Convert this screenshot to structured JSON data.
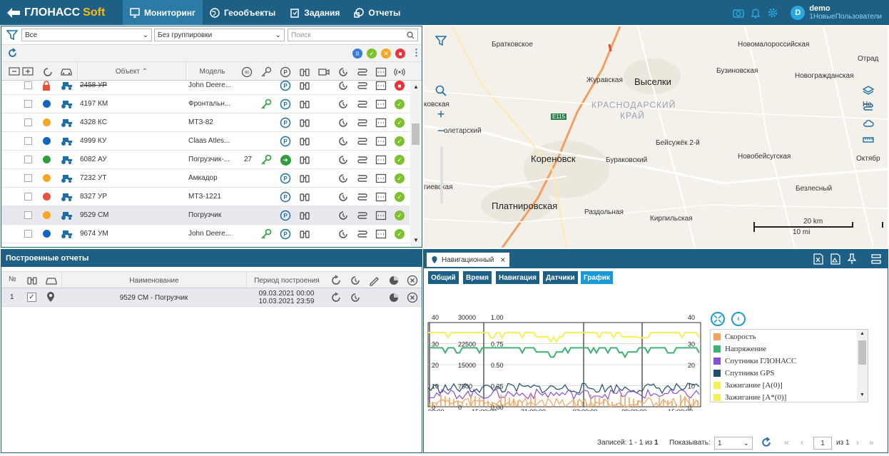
{
  "app": {
    "logo_main": "ГЛОНАСС",
    "logo_soft": "Soft"
  },
  "nav": [
    {
      "label": "Мониторинг",
      "icon": "monitor-icon",
      "active": true
    },
    {
      "label": "Геообъекты",
      "icon": "globe-icon"
    },
    {
      "label": "Задания",
      "icon": "clipboard-icon"
    },
    {
      "label": "Отчеты",
      "icon": "reports-icon"
    }
  ],
  "user": {
    "initial": "D",
    "name": "demo",
    "group": "1НовыеПользователи"
  },
  "monitoring": {
    "filter_value": "Все",
    "grouping_value": "Без группировки",
    "search_placeholder": "Поиск",
    "col_object": "Объект",
    "col_model": "Модель",
    "rows": [
      {
        "plate": "2458 УР",
        "model": "John Deere...",
        "status": "red-lock",
        "speed": "",
        "key": false,
        "p": "p",
        "ok": "lock"
      },
      {
        "plate": "4197 КМ",
        "model": "Фронтальн...",
        "status": "#1565c0",
        "speed": "",
        "key": true,
        "p": "p",
        "ok": "ok"
      },
      {
        "plate": "4328 КС",
        "model": "МТЗ-82",
        "status": "#f5a623",
        "speed": "",
        "key": false,
        "p": "p",
        "ok": "ok"
      },
      {
        "plate": "4999 КУ",
        "model": "Claas Atles...",
        "status": "#1565c0",
        "speed": "",
        "key": false,
        "p": "p",
        "ok": "ok"
      },
      {
        "plate": "6082 АУ",
        "model": "Погрузчик-...",
        "status": "#2e9d3a",
        "speed": "27",
        "key": true,
        "p": "go",
        "ok": "ok"
      },
      {
        "plate": "7232 УТ",
        "model": "Амкадор",
        "status": "#f5a623",
        "speed": "",
        "key": false,
        "p": "p",
        "ok": "ok"
      },
      {
        "plate": "8327 УР",
        "model": "МТЗ-1221",
        "status": "#e8513a",
        "speed": "",
        "key": false,
        "p": "p",
        "ok": "ok"
      },
      {
        "plate": "9529 СМ",
        "model": "Погрузчик",
        "status": "#f5a623",
        "speed": "",
        "key": false,
        "p": "p",
        "ok": "ok"
      },
      {
        "plate": "9674 УМ",
        "model": "John Deere...",
        "status": "#1565c0",
        "speed": "",
        "key": true,
        "p": "p",
        "ok": "ok"
      }
    ]
  },
  "map": {
    "labels": [
      {
        "t": "Братковское"
      },
      {
        "t": "Новомалороссийская"
      },
      {
        "t": "Отрад"
      },
      {
        "t": "Журавская"
      },
      {
        "t": "Выселки"
      },
      {
        "t": "Бузиновская"
      },
      {
        "t": "Новогражданская"
      },
      {
        "t": "ковская"
      },
      {
        "t": "КРАСНОДАРСКИЙ"
      },
      {
        "t": "КРАЙ"
      },
      {
        "t": "Не"
      },
      {
        "t": "олетарский"
      },
      {
        "t": "E115"
      },
      {
        "t": "Бейсужёк 2-й"
      },
      {
        "t": "Кореновск"
      },
      {
        "t": "Бураковский"
      },
      {
        "t": "Новобейсугская"
      },
      {
        "t": "Октябр"
      },
      {
        "t": "гиевская"
      },
      {
        "t": "Безлесный"
      },
      {
        "t": "Платнировская"
      },
      {
        "t": "Раздольная"
      },
      {
        "t": "Кирпильская"
      }
    ],
    "scale_km": "20 km",
    "scale_mi": "10 mi"
  },
  "reports": {
    "title": "Построенные отчеты",
    "col_num": "№",
    "col_name": "Наименование",
    "col_period": "Период построения",
    "rows": [
      {
        "num": "1",
        "name": "9529 СМ - Погрузчик",
        "from": "09.03.2021 00:00",
        "to": "10.03.2021 23:59"
      }
    ]
  },
  "report_view": {
    "tab": "Навигационный",
    "subtabs": [
      "Общий",
      "Время",
      "Навигация",
      "Датчики",
      "График"
    ],
    "legend": [
      {
        "name": "Скорость",
        "color": "#f4a460"
      },
      {
        "name": "Напряжение",
        "color": "#3cb371"
      },
      {
        "name": "Спутники ГЛОНАСС",
        "color": "#8a4fd8"
      },
      {
        "name": "Спутники GPS",
        "color": "#1e4f6e"
      },
      {
        "name": "Зажигание [A(0)]",
        "color": "#f7ef5a"
      },
      {
        "name": "Зажигание [A*(0)]",
        "color": "#f7ef5a"
      }
    ],
    "footer": {
      "records_label": "Записей: 1 - 1 из",
      "records_total": "1",
      "show_label": "Показывать:",
      "show_value": "1",
      "page": "1",
      "page_of": "из 1"
    }
  },
  "chart_data": {
    "type": "line",
    "x": [
      "00:00",
      "15:00:00",
      "21:00:00",
      "03:00:00",
      "09:00:00",
      "15:00:00"
    ],
    "axes": [
      {
        "ticks": [
          "40",
          "30",
          "20",
          "10",
          "0"
        ]
      },
      {
        "ticks": [
          "30000",
          "22500",
          "15000",
          "7500",
          "0"
        ]
      },
      {
        "ticks": [
          "1.00",
          "0.75",
          "0.50",
          "0.25",
          "0.00"
        ]
      },
      {
        "ticks": [
          "40",
          "30",
          "20",
          "10",
          "0"
        ]
      }
    ],
    "series": [
      {
        "name": "Зажигание [A(0)]",
        "approx_level": 0.88
      },
      {
        "name": "Напряжение",
        "approx_level": 0.7
      },
      {
        "name": "Спутники GPS",
        "approx_level": 0.22
      },
      {
        "name": "Спутники ГЛОНАСС",
        "approx_level": 0.15
      },
      {
        "name": "Скорость",
        "approx_level": 0.05
      }
    ]
  }
}
